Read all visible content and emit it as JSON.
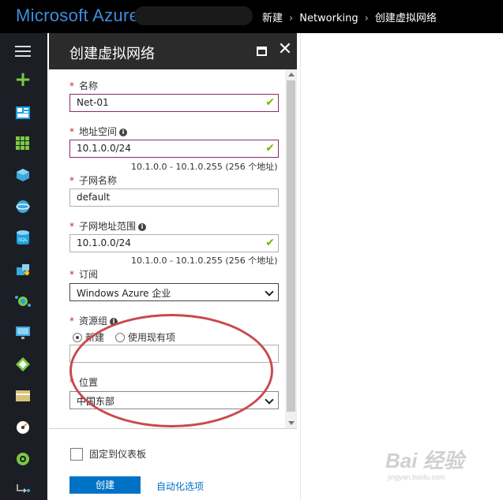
{
  "topbar": {
    "brand": "Microsoft Azure",
    "breadcrumb": [
      "新建",
      "Networking",
      "创建虚拟网络"
    ]
  },
  "sidebar": {
    "icons": [
      "menu-icon",
      "plus-icon",
      "dashboard-icon",
      "all-resources-icon",
      "resource-group-icon",
      "app-services-icon",
      "sql-database-icon",
      "cloud-services-icon",
      "virtual-machines-icon",
      "monitor-icon",
      "cdn-icon",
      "storage-icon",
      "advisor-icon",
      "security-icon",
      "more-services-icon"
    ]
  },
  "blade": {
    "title": "创建虚拟网络",
    "fields": {
      "name": {
        "label": "名称",
        "value": "Net-01"
      },
      "address_space": {
        "label": "地址空间",
        "value": "10.1.0.0/24",
        "hint": "10.1.0.0 - 10.1.0.255 (256 个地址)"
      },
      "subnet_name": {
        "label": "子网名称",
        "value": "default"
      },
      "subnet_range": {
        "label": "子网地址范围",
        "value": "10.1.0.0/24",
        "hint": "10.1.0.0 - 10.1.0.255 (256 个地址)"
      },
      "subscription": {
        "label": "订阅",
        "value": "Windows Azure 企业"
      },
      "resource_group": {
        "label": "资源组",
        "option_new": "新建",
        "option_existing": "使用现有项",
        "value": ""
      },
      "location": {
        "label": "位置",
        "value": "中国东部"
      }
    },
    "footer": {
      "pin_label": "固定到仪表板",
      "create_label": "创建",
      "automation_label": "自动化选项"
    }
  },
  "watermark": {
    "brand": "Bai 经验",
    "url": "jingyan.baidu.com"
  }
}
